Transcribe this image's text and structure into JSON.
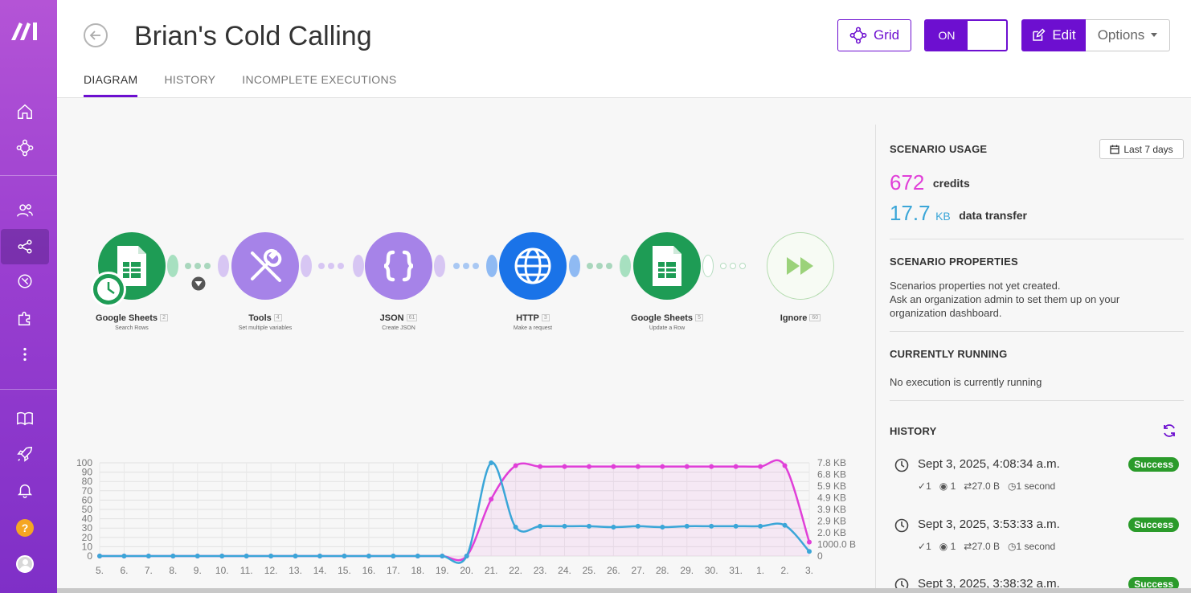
{
  "header": {
    "title": "Brian's Cold Calling",
    "tabs": [
      {
        "label": "DIAGRAM",
        "active": true
      },
      {
        "label": "HISTORY",
        "active": false
      },
      {
        "label": "INCOMPLETE EXECUTIONS",
        "active": false
      }
    ],
    "grid_label": "Grid",
    "toggle_label": "ON",
    "edit_label": "Edit",
    "options_label": "Options"
  },
  "colors": {
    "brand": "#6d0fd0",
    "sheets": "#1e9c55",
    "tools": "#a683e8",
    "json": "#a683e8",
    "http": "#1a73e8",
    "credits": "#e03fd8",
    "transfer": "#3ba6d8",
    "success": "#2b9b2b"
  },
  "modules": [
    {
      "name": "Google Sheets",
      "badge": "2",
      "sub": "Search Rows",
      "icon": "google-sheets-icon"
    },
    {
      "name": "Tools",
      "badge": "4",
      "sub": "Set multiple variables",
      "icon": "wrench-screwdriver-icon"
    },
    {
      "name": "JSON",
      "badge": "61",
      "sub": "Create JSON",
      "icon": "braces-icon"
    },
    {
      "name": "HTTP",
      "badge": "3",
      "sub": "Make a request",
      "icon": "globe-icon"
    },
    {
      "name": "Google Sheets",
      "badge": "5",
      "sub": "Update a Row",
      "icon": "google-sheets-icon"
    },
    {
      "name": "Ignore",
      "badge": "60",
      "sub": "",
      "icon": "fast-forward-icon"
    }
  ],
  "chart_data": {
    "type": "line",
    "categories": [
      "5.",
      "6.",
      "7.",
      "8.",
      "9.",
      "10.",
      "11.",
      "12.",
      "13.",
      "14.",
      "15.",
      "16.",
      "17.",
      "18.",
      "19.",
      "20.",
      "21.",
      "22.",
      "23.",
      "24.",
      "25.",
      "26.",
      "27.",
      "28.",
      "29.",
      "30.",
      "31.",
      "1.",
      "2.",
      "3."
    ],
    "y_ticks_left": [
      "100",
      "90",
      "80",
      "70",
      "60",
      "50",
      "40",
      "30",
      "20",
      "10",
      "0"
    ],
    "y_ticks_right": [
      "7.8 KB",
      "6.8 KB",
      "5.9 KB",
      "4.9 KB",
      "3.9 KB",
      "2.9 KB",
      "2.0 KB",
      "1000.0 B",
      "0"
    ],
    "ylim_left": [
      0,
      100
    ],
    "series": [
      {
        "values": [
          0,
          0,
          0,
          0,
          0,
          0,
          0,
          0,
          0,
          0,
          0,
          0,
          0,
          0,
          0,
          0,
          61,
          97,
          96,
          96,
          96,
          96,
          96,
          96,
          96,
          96,
          96,
          96,
          97,
          15
        ]
      },
      {
        "values": [
          0,
          0,
          0,
          0,
          0,
          0,
          0,
          0,
          0,
          0,
          0,
          0,
          0,
          0,
          0,
          0,
          100,
          31,
          32,
          32,
          32,
          31,
          32,
          31,
          32,
          32,
          32,
          32,
          33,
          5
        ]
      }
    ],
    "grid": true
  },
  "right_panel": {
    "usage_title": "SCENARIO USAGE",
    "range_label": "Last 7 days",
    "credits_value": "672",
    "credits_label": "credits",
    "transfer_value": "17.7",
    "transfer_unit": "KB",
    "transfer_label": "data transfer",
    "properties_title": "SCENARIO PROPERTIES",
    "properties_text_1": "Scenarios properties not yet created.",
    "properties_text_2": "Ask an organization admin to set them up on your organization dashboard.",
    "running_title": "CURRENTLY RUNNING",
    "running_text": "No execution is currently running",
    "history_title": "HISTORY",
    "history": [
      {
        "date": "Sept 3, 2025, 4:08:34 a.m.",
        "status": "Success",
        "ops": "1",
        "views": "1",
        "transfer": "27.0 B",
        "duration": "1 second"
      },
      {
        "date": "Sept 3, 2025, 3:53:33 a.m.",
        "status": "Success",
        "ops": "1",
        "views": "1",
        "transfer": "27.0 B",
        "duration": "1 second"
      },
      {
        "date": "Sept 3, 2025, 3:38:32 a.m.",
        "status": "Success"
      }
    ]
  }
}
